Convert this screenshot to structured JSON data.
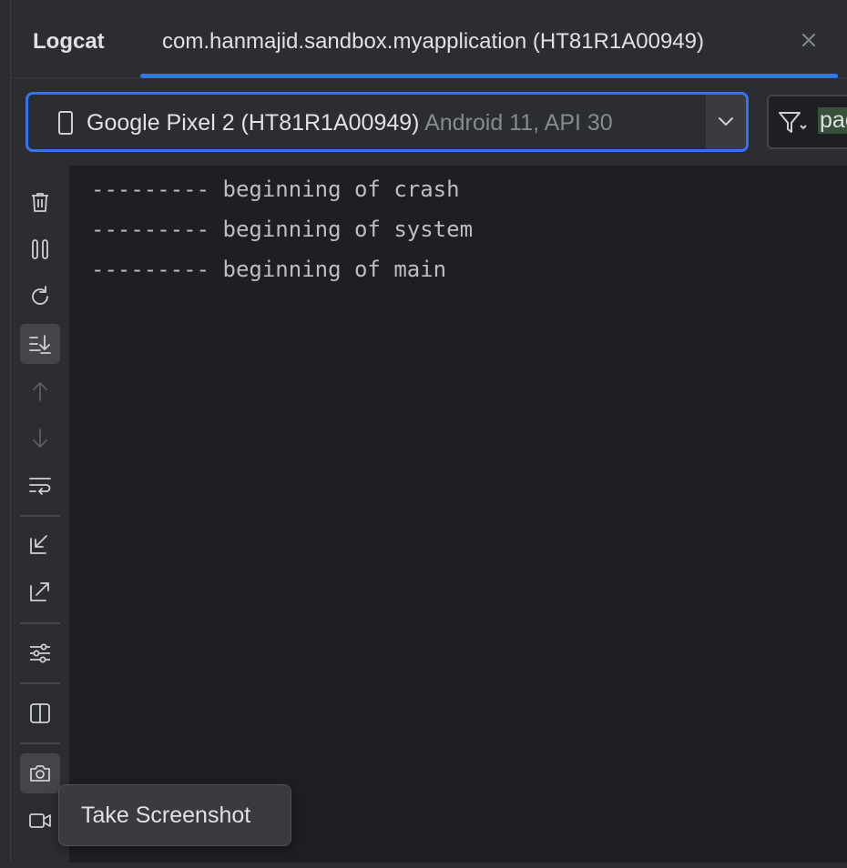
{
  "tool_window": {
    "title": "Logcat",
    "tab": {
      "label": "com.hanmajid.sandbox.myapplication (HT81R1A00949)",
      "close_icon": "close-icon"
    }
  },
  "device_selector": {
    "device_name": "Google Pixel 2 (HT81R1A00949)",
    "device_detail": "Android 11, API 30",
    "icon": "phone-icon",
    "dropdown_icon": "chevron-down-icon"
  },
  "filter": {
    "icon": "filter-icon",
    "value": "pac"
  },
  "sidebar": {
    "buttons": [
      {
        "name": "clear-logcat",
        "icon": "trash-icon"
      },
      {
        "name": "pause",
        "icon": "pause-icon"
      },
      {
        "name": "restart",
        "icon": "restart-icon"
      },
      {
        "name": "scroll-to-end",
        "icon": "scroll-to-end-icon",
        "active": true
      },
      {
        "name": "previous-occurrence",
        "icon": "arrow-up-icon",
        "disabled": true
      },
      {
        "name": "next-occurrence",
        "icon": "arrow-down-icon",
        "disabled": true
      },
      {
        "name": "soft-wrap",
        "icon": "soft-wrap-icon"
      },
      {
        "name": "import",
        "icon": "import-icon"
      },
      {
        "name": "export",
        "icon": "export-icon"
      },
      {
        "name": "configure-formatting",
        "icon": "settings-sliders-icon"
      },
      {
        "name": "split-panels",
        "icon": "split-panel-icon"
      },
      {
        "name": "take-screenshot",
        "icon": "camera-icon",
        "active": true
      },
      {
        "name": "record-screen",
        "icon": "video-camera-icon"
      }
    ]
  },
  "log": {
    "lines": [
      "--------- beginning of crash",
      "--------- beginning of system",
      "--------- beginning of main"
    ]
  },
  "tooltip": {
    "text": "Take Screenshot"
  },
  "colors": {
    "background": "#1e1f22",
    "panel": "#2b2d30",
    "accent": "#3574f0",
    "text": "#dfe1e5",
    "muted_text": "#868a91",
    "search_highlight": "#375239"
  }
}
